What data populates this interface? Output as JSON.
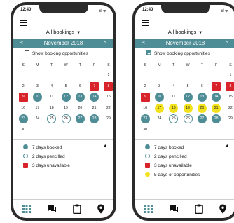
{
  "status": {
    "time": "12:40",
    "signal": "ııl ᯤ"
  },
  "dropdown": {
    "label": "All bookings"
  },
  "month": {
    "title": "November 2018",
    "prev": "<",
    "next": ">"
  },
  "show_opportunities_label": "Show booking opportunities",
  "weekdays": [
    "S",
    "M",
    "T",
    "W",
    "T",
    "F",
    "S"
  ],
  "left_phone": {
    "checked": false,
    "weeks": [
      [
        "",
        "",
        "",
        "",
        "",
        "",
        "1"
      ],
      [
        "2",
        "3",
        "4",
        "5",
        "6",
        "7",
        "8"
      ],
      [
        "9",
        "10",
        "11",
        "12",
        "13",
        "14",
        "15"
      ],
      [
        "16",
        "17",
        "18",
        "19",
        "20",
        "21",
        "22"
      ],
      [
        "23",
        "24",
        "25",
        "26",
        "27",
        "28",
        "29"
      ],
      [
        "30",
        "",
        "",
        "",
        "",
        "",
        ""
      ]
    ],
    "states": {
      "7": "unavail",
      "8": "unavail",
      "9": "unavail",
      "10": "booked",
      "12": "booked",
      "13": "booked",
      "14": "booked",
      "23": "booked",
      "27": "booked",
      "28": "booked",
      "25": "pencilled",
      "26": "pencilled"
    },
    "legend": [
      {
        "kind": "booked",
        "label": "7 days booked"
      },
      {
        "kind": "pencilled",
        "label": "2 days pencilled"
      },
      {
        "kind": "unavail",
        "label": "3 days unavailable"
      }
    ]
  },
  "right_phone": {
    "checked": true,
    "weeks": [
      [
        "",
        "",
        "",
        "",
        "",
        "",
        "1"
      ],
      [
        "2",
        "3",
        "4",
        "5",
        "6",
        "7",
        "8"
      ],
      [
        "9",
        "10",
        "11",
        "12",
        "13",
        "14",
        "15"
      ],
      [
        "16",
        "17",
        "18",
        "19",
        "20",
        "21",
        "22"
      ],
      [
        "23",
        "24",
        "25",
        "26",
        "27",
        "28",
        "29"
      ],
      [
        "30",
        "",
        "",
        "",
        "",
        "",
        ""
      ]
    ],
    "states": {
      "7": "unavail",
      "8": "unavail",
      "9": "unavail",
      "10": "booked",
      "12": "booked",
      "13": "booked",
      "14": "booked",
      "23": "booked",
      "27": "booked",
      "28": "booked",
      "25": "pencilled",
      "26": "pencilled",
      "17": "opp",
      "18": "opp",
      "19": "opp",
      "20": "opp",
      "21": "opp"
    },
    "legend": [
      {
        "kind": "booked",
        "label": "7 days booked"
      },
      {
        "kind": "pencilled",
        "label": "2 days pencilled"
      },
      {
        "kind": "unavail",
        "label": "3 days unavailable"
      },
      {
        "kind": "opp",
        "label": "5 days of opportunities"
      }
    ]
  },
  "colors": {
    "accent": "#4f8d96",
    "unavailable": "#d8232a",
    "opportunity": "#f3e21b"
  },
  "tabs": [
    {
      "icon": "grid-icon"
    },
    {
      "icon": "chat-icon"
    },
    {
      "icon": "clipboard-icon"
    },
    {
      "icon": "location-pin-icon"
    }
  ]
}
